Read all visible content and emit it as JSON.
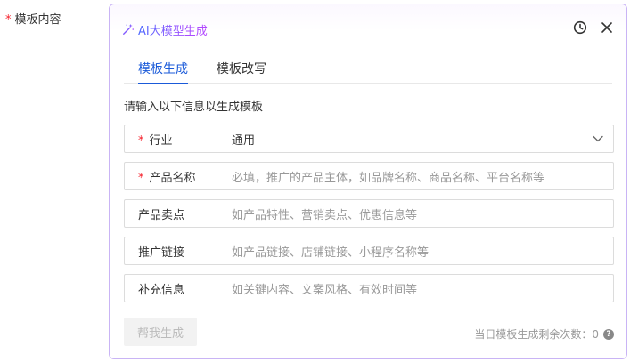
{
  "form": {
    "label": "模板内容",
    "required_mark": "*"
  },
  "panel": {
    "title": "AI大模型生成",
    "icons": {
      "history": "clock-icon",
      "close": "close-icon",
      "title_icon": "magic-wand-icon"
    },
    "tabs": [
      {
        "label": "模板生成",
        "active": true
      },
      {
        "label": "模板改写",
        "active": false
      }
    ],
    "intro": "请输入以下信息以生成模板",
    "fields": [
      {
        "label": "行业",
        "required": true,
        "value": "通用",
        "type": "select"
      },
      {
        "label": "产品名称",
        "required": true,
        "placeholder": "必填，推广的产品主体，如品牌名称、商品名称、平台名称等"
      },
      {
        "label": "产品卖点",
        "required": false,
        "placeholder": "如产品特性、营销卖点、优惠信息等"
      },
      {
        "label": "推广链接",
        "required": false,
        "placeholder": "如产品链接、店铺链接、小程序名称等"
      },
      {
        "label": "补充信息",
        "required": false,
        "placeholder": "如关键内容、文案风格、有效时间等"
      }
    ],
    "generate_button": "帮我生成",
    "remaining_text": "当日模板生成剩余次数：0",
    "help_glyph": "?"
  },
  "colors": {
    "accent": "#1a5ad9",
    "required": "#f5222d",
    "title_gradient_start": "#4f6bff",
    "title_gradient_end": "#b347ff",
    "panel_border": "#c9b4f5"
  }
}
